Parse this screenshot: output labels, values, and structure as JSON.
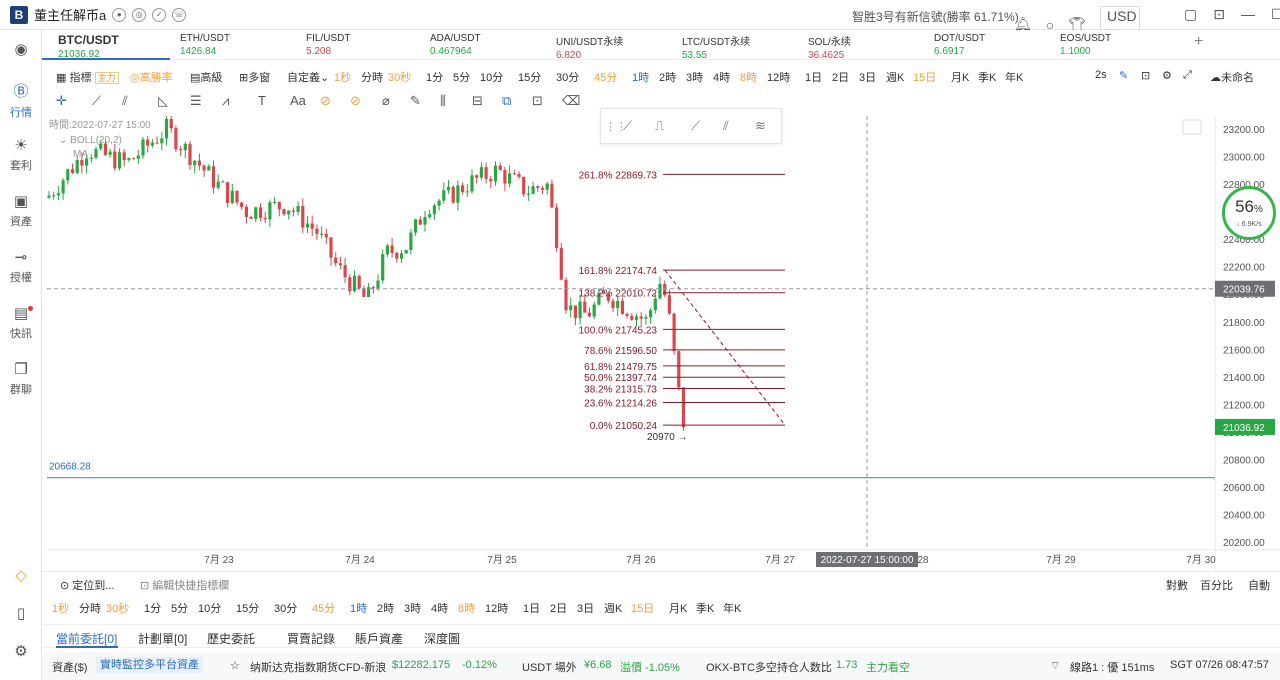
{
  "app": {
    "title": "董主任解币a",
    "promo": "智胜3号有新信號(勝率 61.71%)",
    "currency": "USD"
  },
  "sidebar": {
    "items": [
      {
        "label": "行情"
      },
      {
        "label": "套利"
      },
      {
        "label": "資產"
      },
      {
        "label": "授權"
      },
      {
        "label": "快訊"
      },
      {
        "label": "群聊"
      }
    ]
  },
  "tickers": [
    {
      "name": "BTC/USDT",
      "price": "21036.92",
      "trend": "up"
    },
    {
      "name": "ETH/USDT",
      "price": "1426.84",
      "trend": "up"
    },
    {
      "name": "FIL/USDT",
      "price": "5.208",
      "trend": "down"
    },
    {
      "name": "ADA/USDT",
      "price": "0.467964",
      "trend": "up"
    },
    {
      "name": "UNI/USDT永续",
      "price": "6.820",
      "trend": "down"
    },
    {
      "name": "LTC/USDT永续",
      "price": "53.55",
      "trend": "up"
    },
    {
      "name": "SOL/永续",
      "price": "36.4625",
      "trend": "down"
    },
    {
      "name": "DOT/USDT",
      "price": "6.6917",
      "trend": "up"
    },
    {
      "name": "EOS/USDT",
      "price": "1.1000",
      "trend": "up"
    }
  ],
  "toolbar": {
    "indicator": "指標",
    "main_tag": "主力",
    "high_winrate": "高勝率",
    "advanced": "高級",
    "multi_window": "多窗",
    "custom": "自定義",
    "timeframes": [
      "1秒",
      "分時",
      "30秒",
      "1分",
      "5分",
      "10分",
      "15分",
      "30分",
      "45分",
      "1時",
      "2時",
      "3時",
      "4時",
      "8時",
      "12時",
      "1日",
      "2日",
      "3日",
      "週K",
      "15日",
      "月K",
      "季K",
      "年K"
    ],
    "refresh": "2s",
    "unnamed": "未命名"
  },
  "chart_overlay": {
    "time_label": "時間:2022-07-27 15:00",
    "boll_label": "BOLL(20,2)",
    "ma_label": "MA",
    "lower_line_label": "20668.28",
    "crosshair_price": "22039.76",
    "current_price": "21036.92",
    "crosshair_time": "2022-07-27 15:00:00",
    "low_marker": "20970"
  },
  "badge": {
    "percent": "56",
    "percent_unit": "%",
    "speed": "6.9K/s"
  },
  "chart_data": {
    "type": "candlestick",
    "x_ticks": [
      "7月 23",
      "7月 24",
      "7月 25",
      "7月 26",
      "7月 27",
      "28",
      "7月 29",
      "7月 30"
    ],
    "y_ticks": [
      23200,
      23000,
      22800,
      22600,
      22400,
      22200,
      22000,
      21800,
      21600,
      21400,
      21200,
      21000,
      20800,
      20600,
      20400,
      20200
    ],
    "ylim": [
      20100,
      23250
    ],
    "fibonacci": [
      {
        "label": "261.8%",
        "value": 22869.73
      },
      {
        "label": "161.8%",
        "value": 22174.74
      },
      {
        "label": "138.2%",
        "value": 22010.72
      },
      {
        "label": "100.0%",
        "value": 21745.23
      },
      {
        "label": "78.6%",
        "value": 21596.5
      },
      {
        "label": "61.8%",
        "value": 21479.75
      },
      {
        "label": "50.0%",
        "value": 21397.74
      },
      {
        "label": "38.2%",
        "value": 21315.73
      },
      {
        "label": "23.6%",
        "value": 21214.26
      },
      {
        "label": "0.0%",
        "value": 21050.24
      }
    ]
  },
  "bottom": {
    "locate": "定位到...",
    "edit_shortcuts": "編輯快捷指標欄",
    "log": "對數",
    "percent": "百分比",
    "auto": "自動",
    "timeframes": [
      "1秒",
      "分時",
      "30秒",
      "1分",
      "5分",
      "10分",
      "15分",
      "30分",
      "45分",
      "1時",
      "2時",
      "3時",
      "4時",
      "8時",
      "12時",
      "1日",
      "2日",
      "3日",
      "週K",
      "15日",
      "月K",
      "季K",
      "年K"
    ],
    "tabs": [
      "當前委託[0]",
      "計劃單[0]",
      "歷史委託",
      "買賣記錄",
      "賬戶資產",
      "深度圖"
    ]
  },
  "statusbar": {
    "assets": "資產($)",
    "monitor": "實時監控多平台資產",
    "news_label": "纳斯达克指数期货CFD-新浪",
    "news_price": "$12282.175",
    "news_change": "-0.12%",
    "usdt_label": "USDT 場外",
    "usdt_price": "¥6.68",
    "usdt_premium": "溢價 -1.05%",
    "okx_label": "OKX-BTC多空持仓人数比",
    "okx_value": "1.73",
    "okx_side": "主力看空",
    "route": "線路1 : 優 151ms",
    "clock": "SGT 07/26 08:47:57"
  },
  "colors": {
    "up": "#29a744",
    "down": "#d9474b",
    "accent": "#2b6cc4",
    "fib": "#8b1a2a"
  }
}
